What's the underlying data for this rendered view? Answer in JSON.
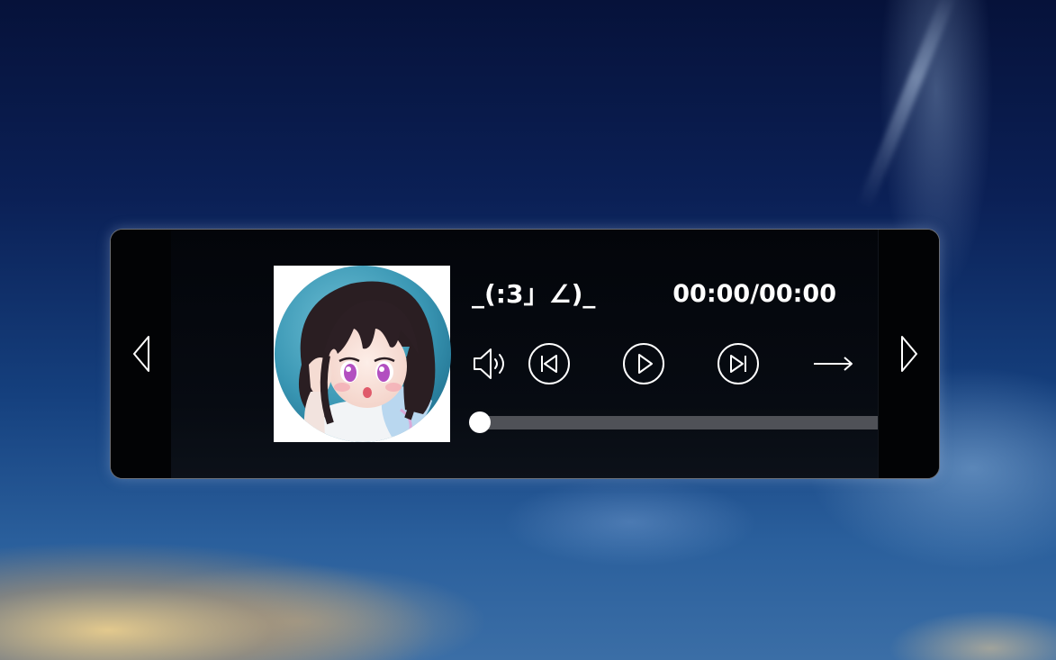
{
  "player": {
    "song_title": "_(:3」∠)_",
    "time_display": "00:00/00:00",
    "progress": 0.0
  },
  "icons": {
    "prev_page": "chevron-left-icon",
    "next_page": "chevron-right-icon",
    "volume": "volume-icon",
    "previous": "skip-previous-icon",
    "play": "play-icon",
    "next": "skip-next-icon",
    "mode": "arrow-right-icon"
  },
  "colors": {
    "accent": "#ffffff",
    "panel": "#05070c",
    "track": "#4f5157"
  }
}
